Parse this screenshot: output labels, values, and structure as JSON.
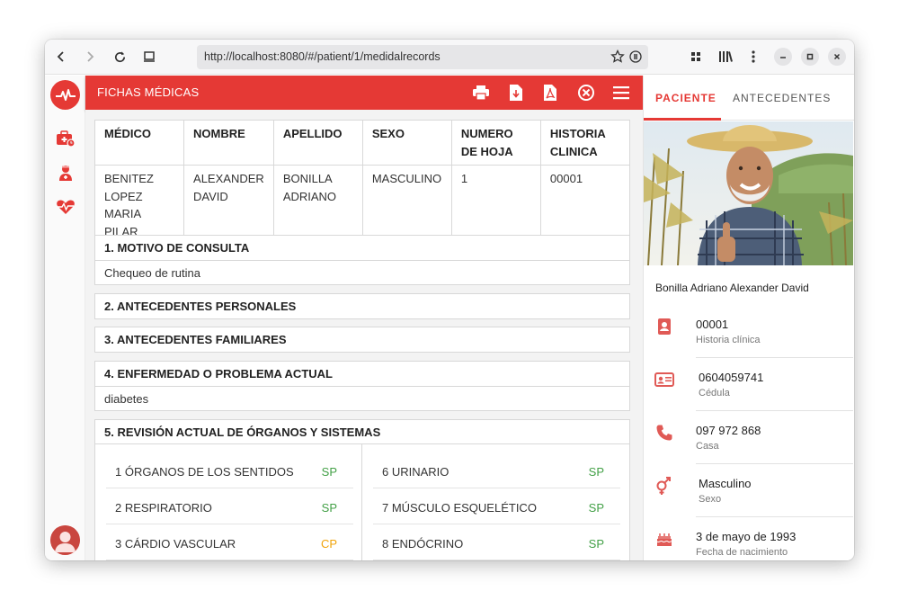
{
  "browser": {
    "url": "http://localhost:8080/#/patient/1/medidalrecords"
  },
  "colors": {
    "accent": "#e53935",
    "status_sp": "#43a047",
    "status_cp": "#f0a30a"
  },
  "header": {
    "title": "FICHAS MÉDICAS"
  },
  "record_table": {
    "headers": [
      "MÉDICO",
      "NOMBRE",
      "APELLIDO",
      "SEXO",
      "NUMERO DE HOJA",
      "HISTORIA CLINICA"
    ],
    "row": [
      "BENITEZ LOPEZ MARIA PILAR",
      "ALEXANDER DAVID",
      "BONILLA ADRIANO",
      "MASCULINO",
      "1",
      "00001"
    ]
  },
  "sections": [
    {
      "title": "1. MOTIVO DE CONSULTA",
      "body": "Chequeo de rutina"
    },
    {
      "title": "2. ANTECEDENTES PERSONALES"
    },
    {
      "title": "3. ANTECEDENTES FAMILIARES"
    },
    {
      "title": "4. ENFERMEDAD O PROBLEMA ACTUAL",
      "body": "diabetes"
    },
    {
      "title": "5. REVISIÓN ACTUAL DE ÓRGANOS Y SISTEMAS"
    }
  ],
  "review": {
    "left": [
      {
        "label": "1 ÓRGANOS DE LOS SENTIDOS",
        "value": "SP"
      },
      {
        "label": "2 RESPIRATORIO",
        "value": "SP"
      },
      {
        "label": "3 CÁRDIO VASCULAR",
        "value": "CP"
      }
    ],
    "right": [
      {
        "label": "6 URINARIO",
        "value": "SP"
      },
      {
        "label": "7 MÚSCULO ESQUELÉTICO",
        "value": "SP"
      },
      {
        "label": "8 ENDÓCRINO",
        "value": "SP"
      }
    ]
  },
  "panel": {
    "tabs": [
      "PACIENTE",
      "ANTECEDENTES"
    ],
    "patient_name": "Bonilla Adriano Alexander David",
    "info": [
      {
        "icon": "contact-card-icon",
        "value": "00001",
        "label": "Historia clínica"
      },
      {
        "icon": "id-card-icon",
        "value": "0604059741",
        "label": "Cédula"
      },
      {
        "icon": "phone-icon",
        "value": "097 972 868",
        "label": "Casa"
      },
      {
        "icon": "gender-icon",
        "value": "Masculino",
        "label": "Sexo"
      },
      {
        "icon": "birthday-cake-icon",
        "value": "3 de mayo de 1993",
        "label": "Fecha de nacimiento"
      }
    ]
  }
}
